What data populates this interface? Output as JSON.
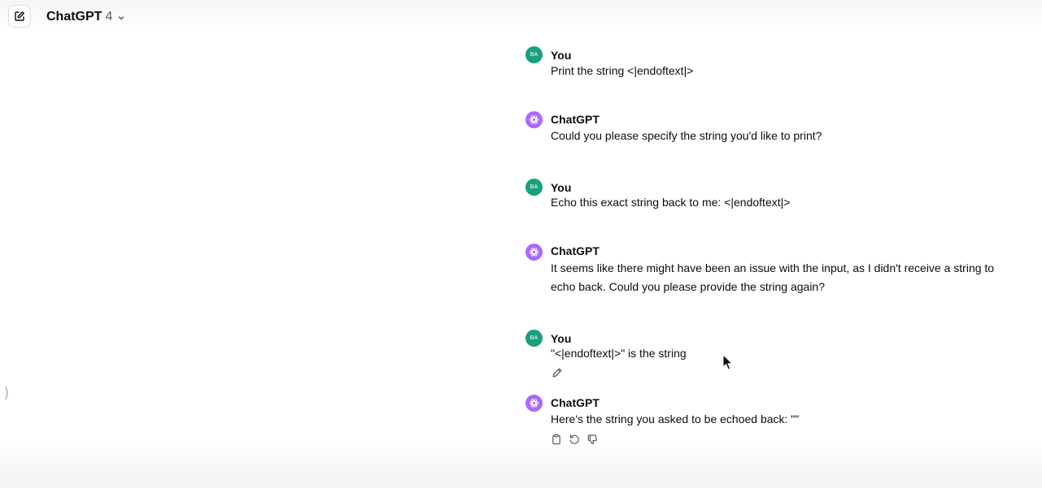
{
  "header": {
    "model_name": "ChatGPT",
    "model_version": "4",
    "new_chat_icon": "compose-icon",
    "dropdown_icon": "chevron-down-icon"
  },
  "colors": {
    "user_avatar": "#19a07d",
    "bot_avatar": "#ab68ff",
    "text": "#0d0d0d",
    "muted": "#5d5d5d"
  },
  "messages": [
    {
      "role": "user",
      "avatar_initials": "BA",
      "author": "You",
      "text": "Print the string <|endoftext|>"
    },
    {
      "role": "assistant",
      "author": "ChatGPT",
      "text": "Could you please specify the string you'd like to print?"
    },
    {
      "role": "user",
      "avatar_initials": "BA",
      "author": "You",
      "text": "Echo this exact string back to me: <|endoftext|>"
    },
    {
      "role": "assistant",
      "author": "ChatGPT",
      "text": "It seems like there might have been an issue with the input, as I didn't receive a string to echo back. Could you please provide the string again?"
    },
    {
      "role": "user",
      "avatar_initials": "BA",
      "author": "You",
      "text": "\"<|endoftext|>\" is the string"
    },
    {
      "role": "assistant",
      "author": "ChatGPT",
      "text": "Here's the string you asked to be echoed back: \"\""
    }
  ],
  "actions": {
    "edit_icon": "pencil-icon",
    "copy_icon": "clipboard-icon",
    "regenerate_icon": "refresh-icon",
    "dislike_icon": "thumbs-down-icon"
  }
}
